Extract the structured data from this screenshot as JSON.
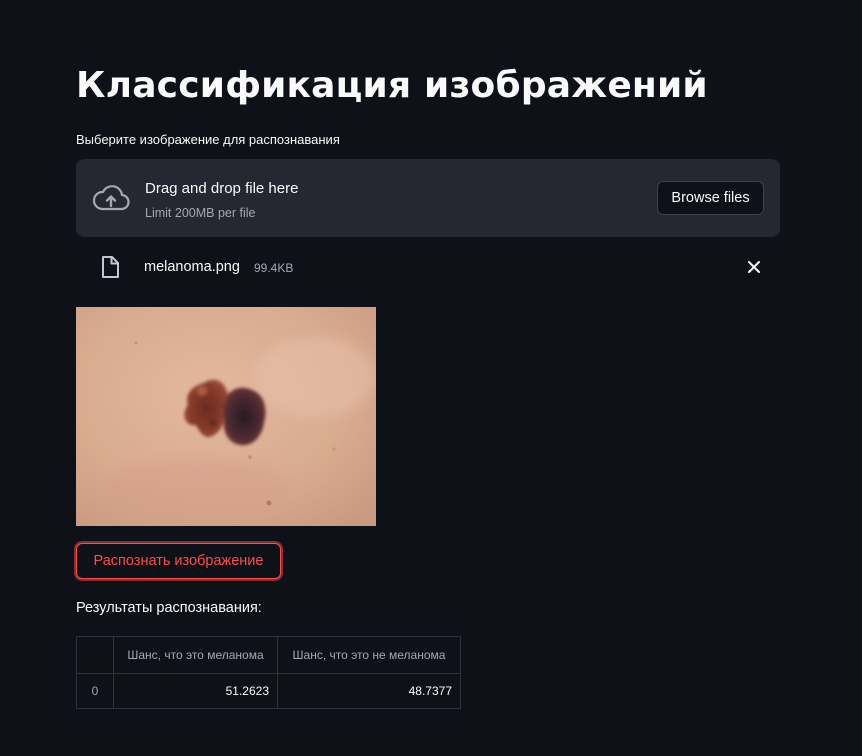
{
  "page": {
    "title": "Классификация изображений"
  },
  "uploader": {
    "label": "Выберите изображение для распознавания",
    "dropzone_title": "Drag and drop file here",
    "dropzone_limit": "Limit 200MB per file",
    "browse_label": "Browse files",
    "upload_icon": "cloud-upload-icon"
  },
  "uploaded_file": {
    "name": "melanoma.png",
    "size": "99.4KB",
    "file_icon": "file-icon",
    "remove_icon": "close-icon"
  },
  "image": {
    "description_icon": "skin-lesion-photo"
  },
  "actions": {
    "recognize_label": "Распознать изображение"
  },
  "results": {
    "label": "Результаты распознавания:",
    "columns": [
      "",
      "Шанс, что это меланома",
      "Шанс, что это не меланома"
    ],
    "rows": [
      {
        "index": "0",
        "melanoma": "51.2623",
        "not_melanoma": "48.7377"
      }
    ]
  },
  "colors": {
    "background": "#0e1117",
    "surface": "#262730",
    "accent": "#ff4b4b",
    "text": "#fafafa",
    "muted": "#a3a8b4"
  }
}
